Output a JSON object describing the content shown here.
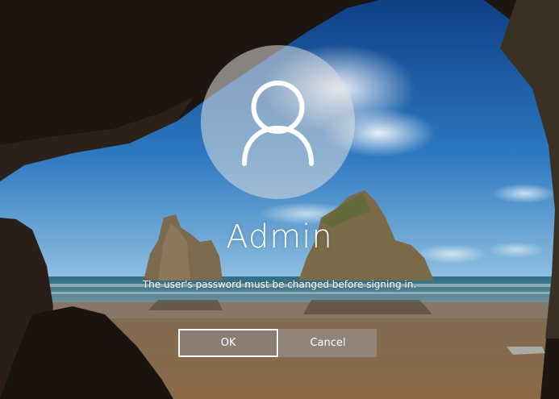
{
  "user": {
    "name": "Admin",
    "avatar_icon": "user-icon"
  },
  "dialog": {
    "message": "The user's password must be changed before signing in.",
    "ok_label": "OK",
    "cancel_label": "Cancel"
  },
  "colors": {
    "sky": "#1d5fa8",
    "sea": "#2f6f8a",
    "sand": "#8a6a47",
    "cave": "#1e1712"
  }
}
